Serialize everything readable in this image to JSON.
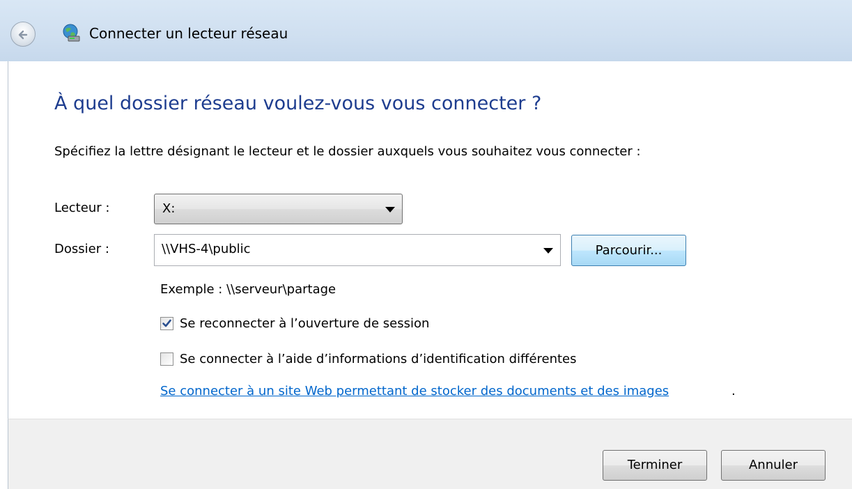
{
  "window": {
    "title": "Connecter un lecteur réseau",
    "back_icon": "back-arrow-icon",
    "app_icon": "network-drive-icon"
  },
  "main": {
    "heading": "À quel dossier réseau voulez-vous vous connecter ?",
    "instruction": "Spécifiez la lettre désignant le lecteur et le dossier auxquels vous souhaitez vous connecter :",
    "drive": {
      "label": "Lecteur :",
      "value": "X:"
    },
    "folder": {
      "label": "Dossier :",
      "value": "\\\\VHS-4\\public",
      "browse_label": "Parcourir..."
    },
    "example": "Exemple : \\\\serveur\\partage",
    "reconnect": {
      "label": "Se reconnecter à l’ouverture de session",
      "checked": true
    },
    "different_credentials": {
      "label": "Se connecter à l’aide d’informations d’identification différentes",
      "checked": false
    },
    "web_link": {
      "text": "Se connecter à un site Web permettant de stocker des documents et des images",
      "suffix": "."
    }
  },
  "footer": {
    "finish_label": "Terminer",
    "cancel_label": "Annuler"
  },
  "colors": {
    "heading": "#1e3d8f",
    "link": "#0066cc",
    "titlebar": "#cfdff0",
    "footer": "#f0f0f0"
  }
}
